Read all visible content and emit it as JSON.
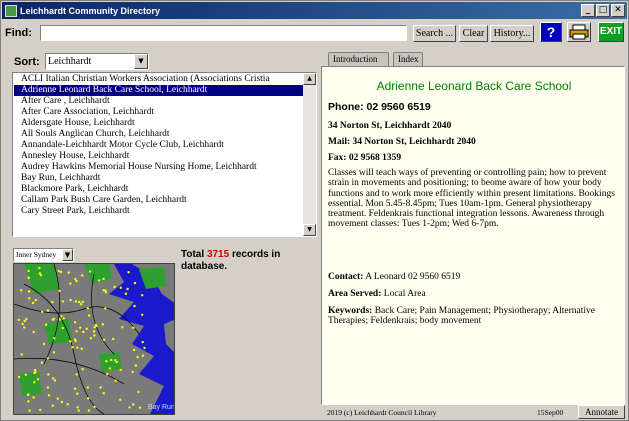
{
  "window": {
    "title": "Leichhardt Community Directory",
    "buttons": [
      "_",
      "□",
      "✕"
    ]
  },
  "find": {
    "label": "Find:",
    "value": "",
    "search_label": "Search ...",
    "clear_label": "Clear",
    "history_label": "History...",
    "help_label": "?",
    "exit_label": "EXIT"
  },
  "sort": {
    "label": "Sort:",
    "selected": "Leichhardt"
  },
  "list": {
    "items": [
      "ACLI Italian Christian Workers Association (Associations Cristia",
      "Adrienne Leonard Back Care School,  Leichhardt",
      "After Care ,  Leichhardt",
      "After Care Association,  Leichhardt",
      "Aldersgate House,  Leichhardt",
      "All Souls Anglican Church,  Leichhardt",
      "Annandale-Leichhardt Motor Cycle Club,  Leichhardt",
      "Annesley House,  Leichhardt",
      "Audrey Hawkins Memorial House Nursing Home,  Leichhardt",
      "Bay Run,  Leichhardt",
      "Blackmore Park,  Leichhardt",
      "Callam Park Bush Care Garden,  Leichhardt",
      "Cary Street Park,  Leichhardt"
    ],
    "selected_index": 1
  },
  "region": {
    "selected": "Inner Sydney"
  },
  "total": {
    "prefix": "Total ",
    "count": "3715",
    "suffix": " records in database."
  },
  "map": {
    "label": "Bay Run"
  },
  "tabs": {
    "introduction": "Introduction",
    "index": "Index"
  },
  "detail": {
    "title": "Adrienne Leonard Back Care School",
    "phone": "Phone: 02 9560 6519",
    "address": "34 Norton St,  Leichhardt  2040",
    "mail": "Mail: 34 Norton St,  Leichhardt  2040",
    "fax": "Fax: 02 9568 1359",
    "description": "Classes will teach ways of preventing or controlling pain; how to prevent strain in movements and positioning; to beome aware of how your body functions and to work more efficiently within present limitations.  Bookings essential. Mon 5.45-8.45pm; Tues 10am-1pm. General physiotherapy treatment.  Feldenkrais functional integration lessons. Awareness  through movement classes: Tues 1-2pm; Wed 6-7pm.",
    "contact_label": "Contact:",
    "contact_value": " A Leonard 02 9560 6519",
    "area_label": "Area Served:",
    "area_value": " Local Area",
    "keywords_label": "Keywords:",
    "keywords_value": " Back Care; Pain Management; Physiotherapy; Alternative Therapies; Feldenkrais; body movement"
  },
  "status": {
    "copyright": "2019 (c) Leichhardt Council Library",
    "date": "15Sep00",
    "annotate_label": "Annotate"
  },
  "colors": {
    "title_green": "#008000",
    "selection": "#000080",
    "count_red": "#d00000",
    "map_water": "#1a1acc",
    "map_land": "#7a7a7a",
    "map_parks": "#2fa02f",
    "map_points": "#ffff00"
  }
}
